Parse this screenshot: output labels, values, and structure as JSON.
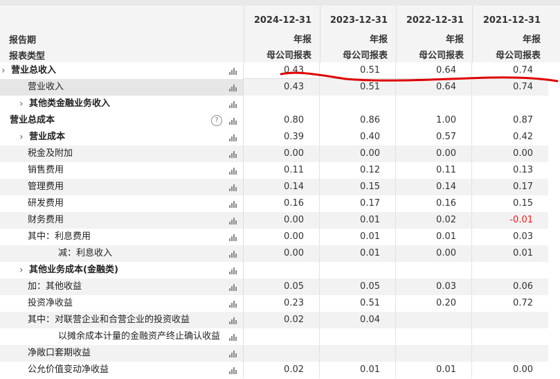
{
  "header": {
    "label_period": "报告期",
    "label_type": "报表类型",
    "columns": [
      {
        "date": "2024-12-31",
        "period_type": "年报",
        "statement": "母公司报表"
      },
      {
        "date": "2023-12-31",
        "period_type": "年报",
        "statement": "母公司报表"
      },
      {
        "date": "2022-12-31",
        "period_type": "年报",
        "statement": "母公司报表"
      },
      {
        "date": "2021-12-31",
        "period_type": "年报",
        "statement": "母公司报表"
      }
    ]
  },
  "rows": [
    {
      "label": "营业总收入",
      "values": [
        "0.43",
        "0.51",
        "0.64",
        "0.74"
      ]
    },
    {
      "label": "营业收入",
      "values": [
        "0.43",
        "0.51",
        "0.64",
        "0.74"
      ]
    },
    {
      "label": "其他类金融业务收入",
      "values": [
        "",
        "",
        "",
        ""
      ]
    },
    {
      "label": "营业总成本",
      "values": [
        "0.80",
        "0.86",
        "1.00",
        "0.87"
      ]
    },
    {
      "label": "营业成本",
      "values": [
        "0.39",
        "0.40",
        "0.57",
        "0.42"
      ]
    },
    {
      "label": "税金及附加",
      "values": [
        "0.00",
        "0.00",
        "0.00",
        "0.00"
      ]
    },
    {
      "label": "销售费用",
      "values": [
        "0.11",
        "0.12",
        "0.11",
        "0.13"
      ]
    },
    {
      "label": "管理费用",
      "values": [
        "0.14",
        "0.15",
        "0.14",
        "0.17"
      ]
    },
    {
      "label": "研发费用",
      "values": [
        "0.16",
        "0.17",
        "0.16",
        "0.15"
      ]
    },
    {
      "label": "财务费用",
      "values": [
        "0.00",
        "0.01",
        "0.02",
        "-0.01"
      ]
    },
    {
      "label": "其中：利息费用",
      "values": [
        "0.00",
        "0.01",
        "0.01",
        "0.03"
      ]
    },
    {
      "label": "减：利息收入",
      "values": [
        "0.00",
        "0.01",
        "0.00",
        "0.01"
      ]
    },
    {
      "label": "其他业务成本(金融类)",
      "values": [
        "",
        "",
        "",
        ""
      ]
    },
    {
      "label": "加：其他收益",
      "values": [
        "0.05",
        "0.05",
        "0.03",
        "0.06"
      ]
    },
    {
      "label": "投资净收益",
      "values": [
        "0.23",
        "0.51",
        "0.20",
        "0.72"
      ]
    },
    {
      "label": "其中：对联营企业和合营企业的投资收益",
      "values": [
        "0.02",
        "0.04",
        "",
        ""
      ]
    },
    {
      "label": "以摊余成本计量的金融资产终止确认收益",
      "values": [
        "",
        "",
        "",
        ""
      ]
    },
    {
      "label": "净敞口套期收益",
      "values": [
        "",
        "",
        "",
        ""
      ]
    },
    {
      "label": "公允价值变动净收益",
      "values": [
        "0.02",
        "0.01",
        "0.01",
        "0.00"
      ]
    }
  ],
  "icons": {
    "chart": "bar-chart-icon",
    "help": "help-circle-icon",
    "expand": "chevron-right-icon"
  },
  "colors": {
    "negative": "#e02020",
    "annotation": "#e00000"
  },
  "help_glyph": "?",
  "chevron_glyph": "›"
}
